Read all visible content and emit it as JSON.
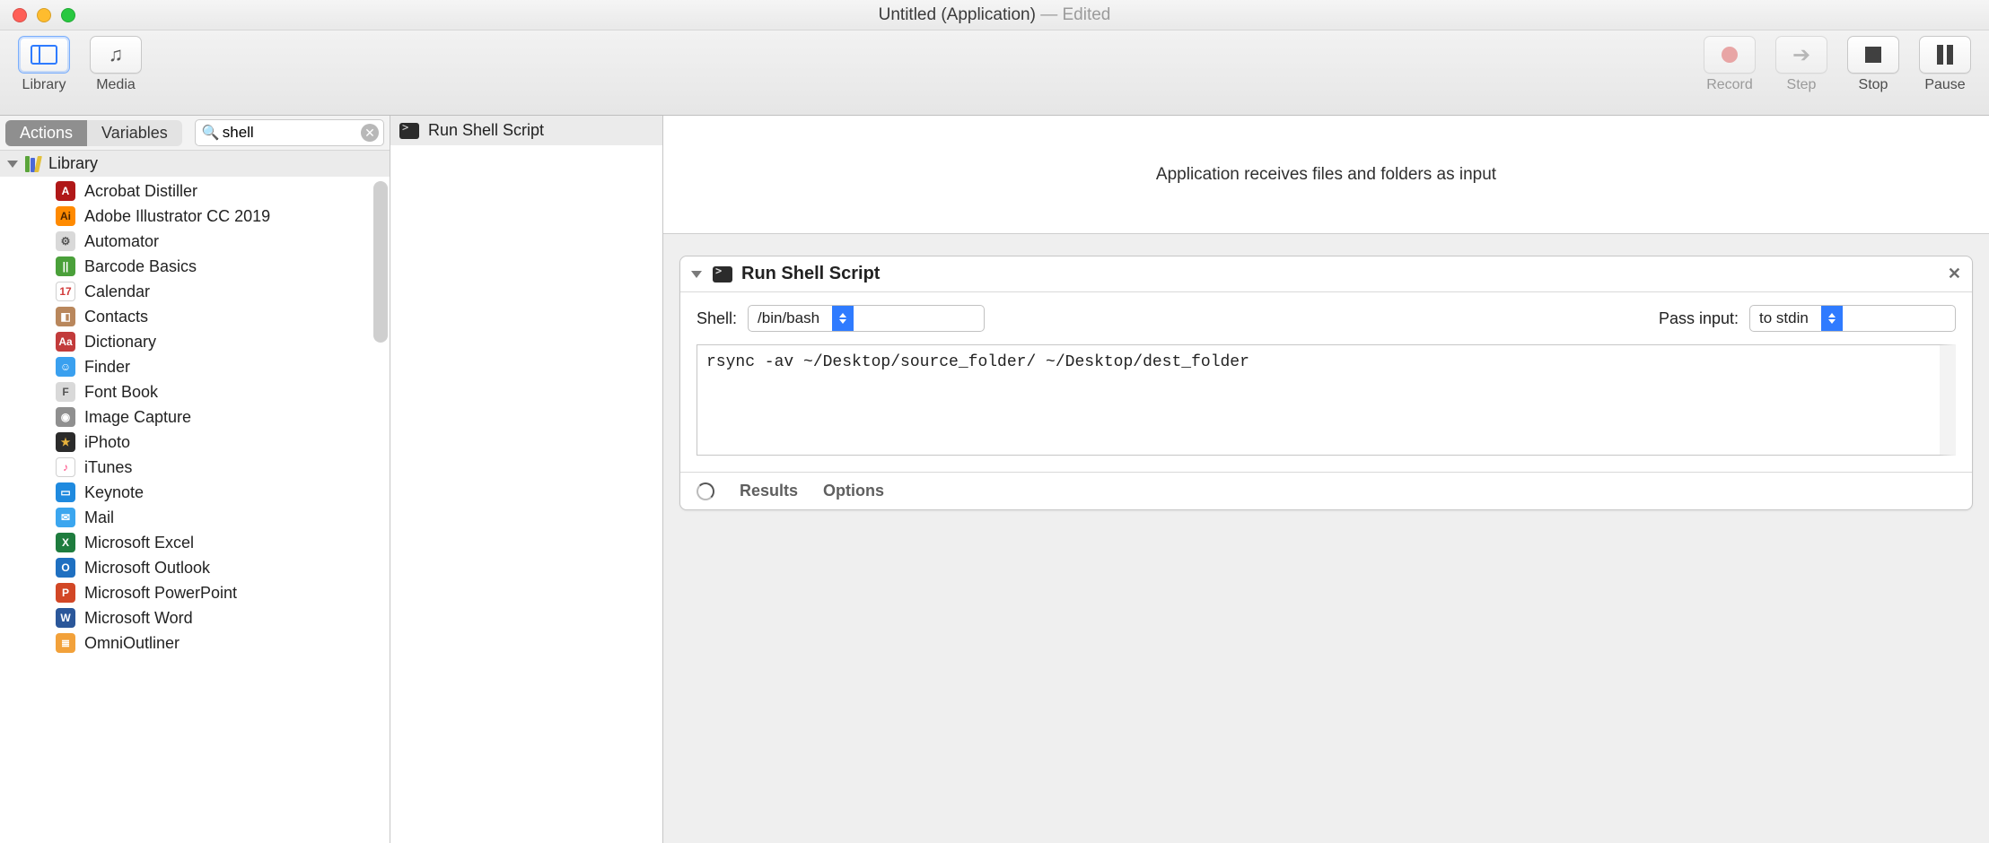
{
  "window": {
    "title_primary": "Untitled (Application)",
    "title_secondary": " — Edited"
  },
  "toolbar": {
    "library_label": "Library",
    "media_label": "Media",
    "record_label": "Record",
    "step_label": "Step",
    "stop_label": "Stop",
    "pause_label": "Pause"
  },
  "library_pane": {
    "tab_actions": "Actions",
    "tab_variables": "Variables",
    "search_value": "shell",
    "tree_root_label": "Library",
    "apps": [
      {
        "name": "Acrobat Distiller",
        "bg": "#b01818",
        "fg": "#fff",
        "short": "A"
      },
      {
        "name": "Adobe Illustrator CC 2019",
        "bg": "#ff8a00",
        "fg": "#4b2400",
        "short": "Ai"
      },
      {
        "name": "Automator",
        "bg": "#d9d9d9",
        "fg": "#555",
        "short": "⚙"
      },
      {
        "name": "Barcode Basics",
        "bg": "#4aa03a",
        "fg": "#fff",
        "short": "||"
      },
      {
        "name": "Calendar",
        "bg": "#ffffff",
        "fg": "#d23b3b",
        "short": "17"
      },
      {
        "name": "Contacts",
        "bg": "#b9875c",
        "fg": "#fff",
        "short": "◧"
      },
      {
        "name": "Dictionary",
        "bg": "#c23b3b",
        "fg": "#fff",
        "short": "Aa"
      },
      {
        "name": "Finder",
        "bg": "#3aa0ef",
        "fg": "#fff",
        "short": "☺"
      },
      {
        "name": "Font Book",
        "bg": "#d9d9d9",
        "fg": "#555",
        "short": "F"
      },
      {
        "name": "Image Capture",
        "bg": "#8f8f8f",
        "fg": "#fff",
        "short": "◉"
      },
      {
        "name": "iPhoto",
        "bg": "#2b2b2b",
        "fg": "#e8b23c",
        "short": "★"
      },
      {
        "name": "iTunes",
        "bg": "#ffffff",
        "fg": "#ff3b79",
        "short": "♪"
      },
      {
        "name": "Keynote",
        "bg": "#1f8adf",
        "fg": "#fff",
        "short": "▭"
      },
      {
        "name": "Mail",
        "bg": "#3ba6ef",
        "fg": "#fff",
        "short": "✉"
      },
      {
        "name": "Microsoft Excel",
        "bg": "#1e7c3e",
        "fg": "#fff",
        "short": "X"
      },
      {
        "name": "Microsoft Outlook",
        "bg": "#1f70c1",
        "fg": "#fff",
        "short": "O"
      },
      {
        "name": "Microsoft PowerPoint",
        "bg": "#d24726",
        "fg": "#fff",
        "short": "P"
      },
      {
        "name": "Microsoft Word",
        "bg": "#2b579a",
        "fg": "#fff",
        "short": "W"
      },
      {
        "name": "OmniOutliner",
        "bg": "#f2a13a",
        "fg": "#fff",
        "short": "≣"
      }
    ]
  },
  "actions_list": {
    "items": [
      "Run Shell Script"
    ]
  },
  "workflow": {
    "banner_text": "Application receives files and folders as input",
    "card": {
      "title": "Run Shell Script",
      "shell_label": "Shell:",
      "shell_value": "/bin/bash",
      "passinput_label": "Pass input:",
      "passinput_value": "to stdin",
      "script_text": "rsync -av ~/Desktop/source_folder/ ~/Desktop/dest_folder",
      "footer_results": "Results",
      "footer_options": "Options"
    }
  }
}
